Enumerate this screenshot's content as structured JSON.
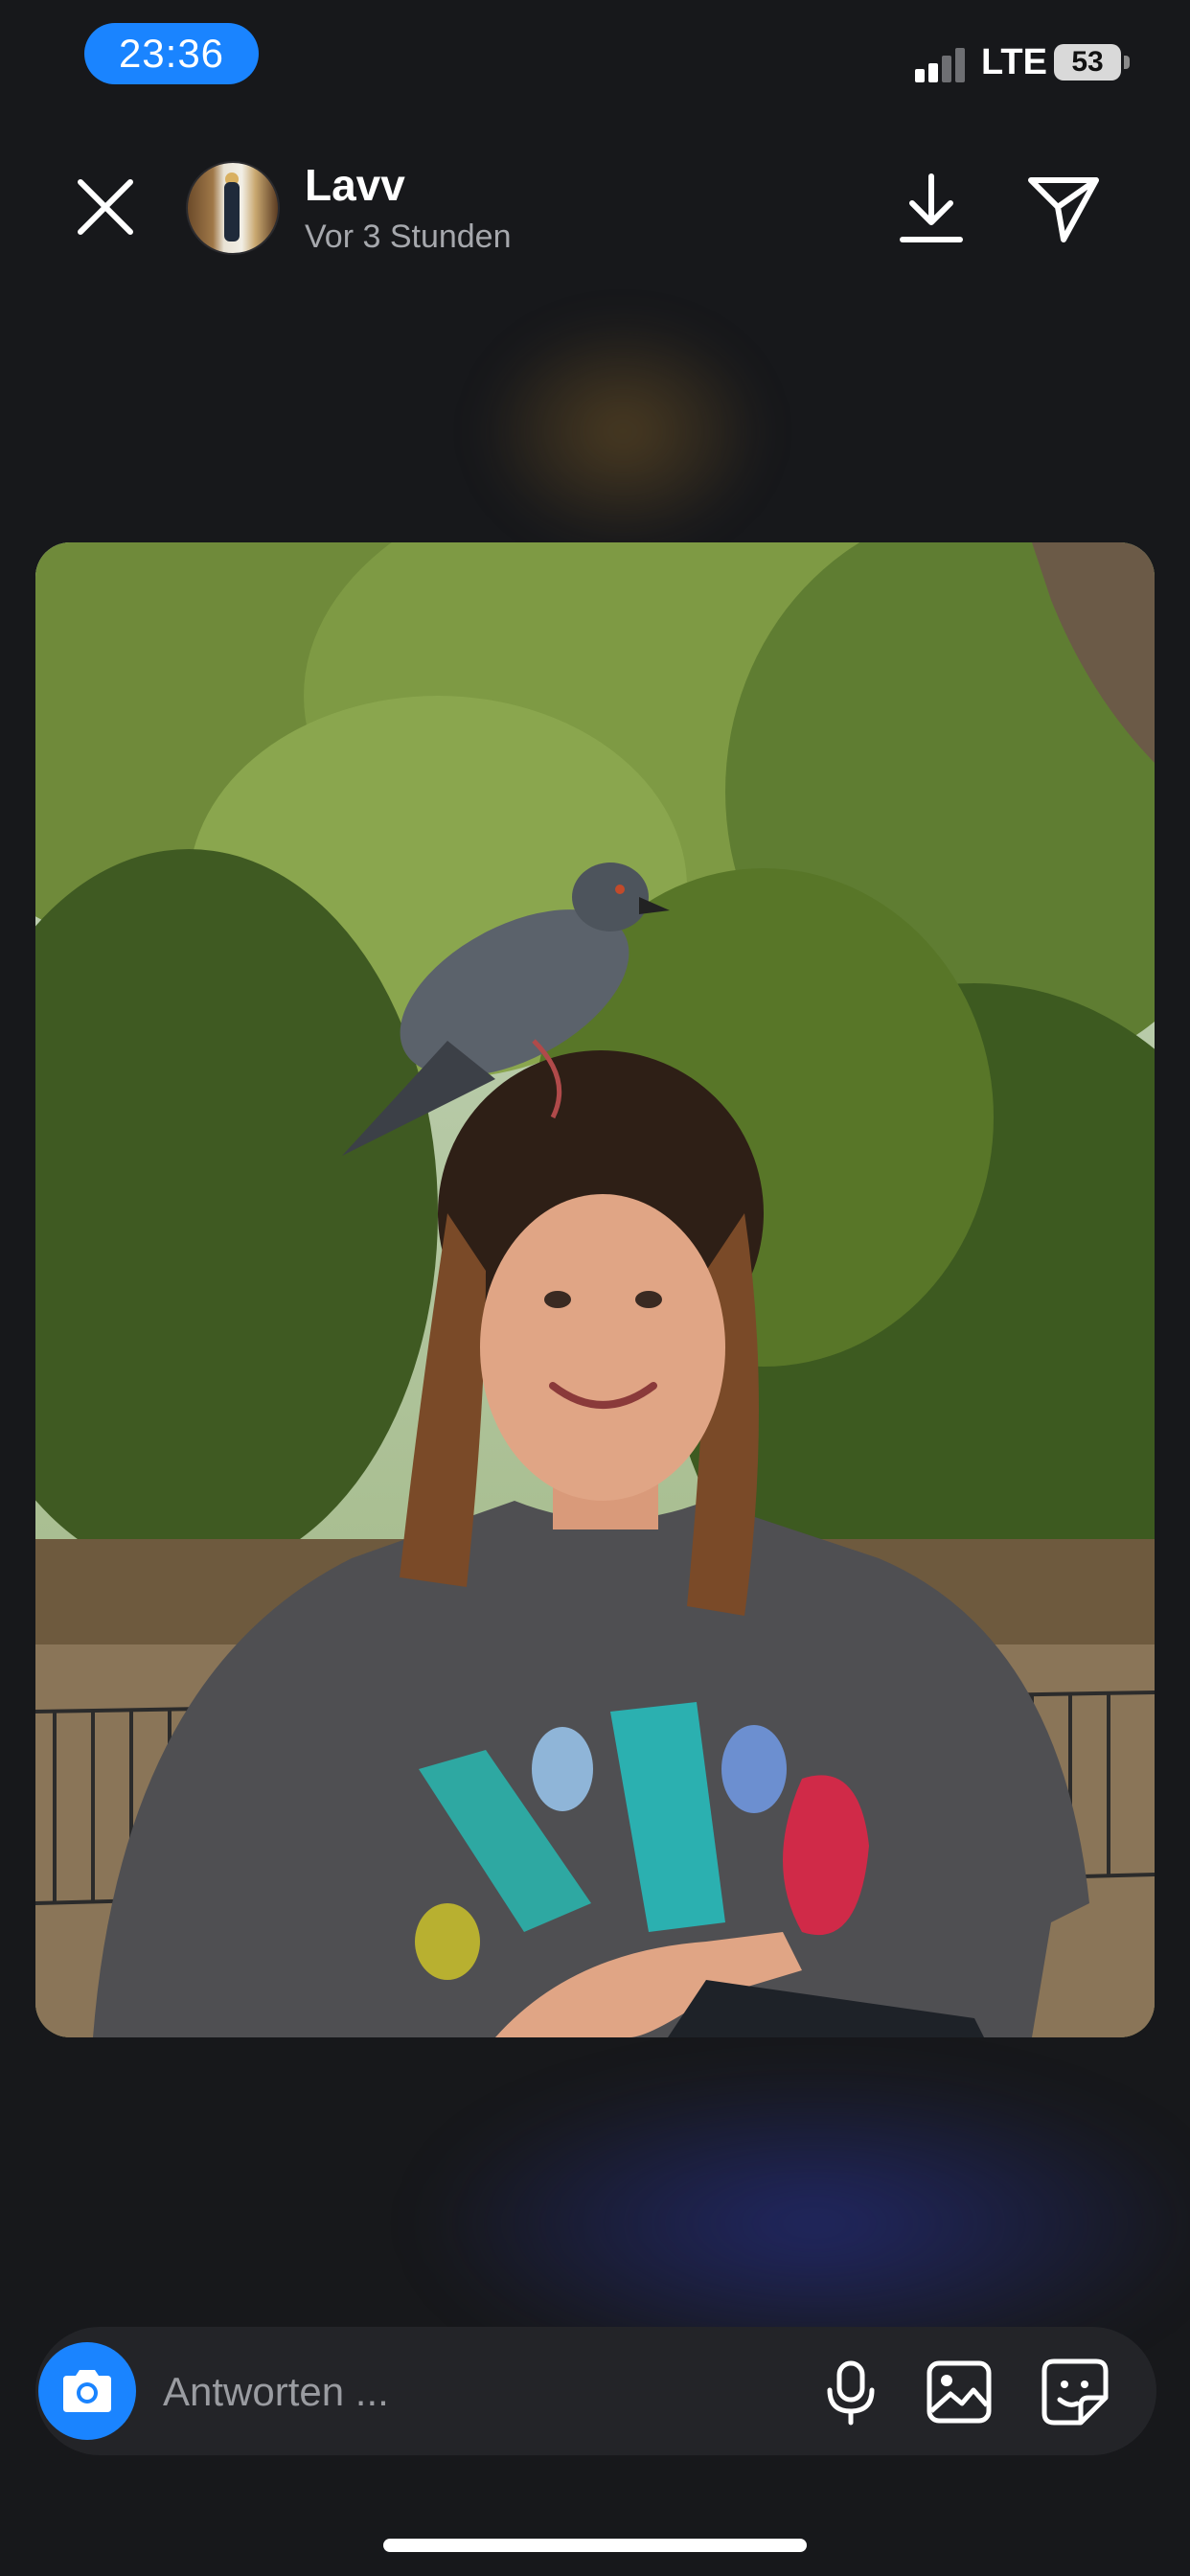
{
  "status_bar": {
    "time": "23:36",
    "network": "LTE",
    "battery": "53"
  },
  "header": {
    "user_name": "Lavv",
    "post_time": "Vor 3 Stunden"
  },
  "icons": {
    "close": "close-icon",
    "download": "download-icon",
    "send": "send-icon",
    "camera": "camera-icon",
    "mic": "mic-icon",
    "gallery": "gallery-icon",
    "sticker": "sticker-icon"
  },
  "reply": {
    "placeholder": "Antworten ..."
  },
  "colors": {
    "accent": "#1a84ff",
    "background": "#17181b",
    "input_bg": "#232428"
  }
}
